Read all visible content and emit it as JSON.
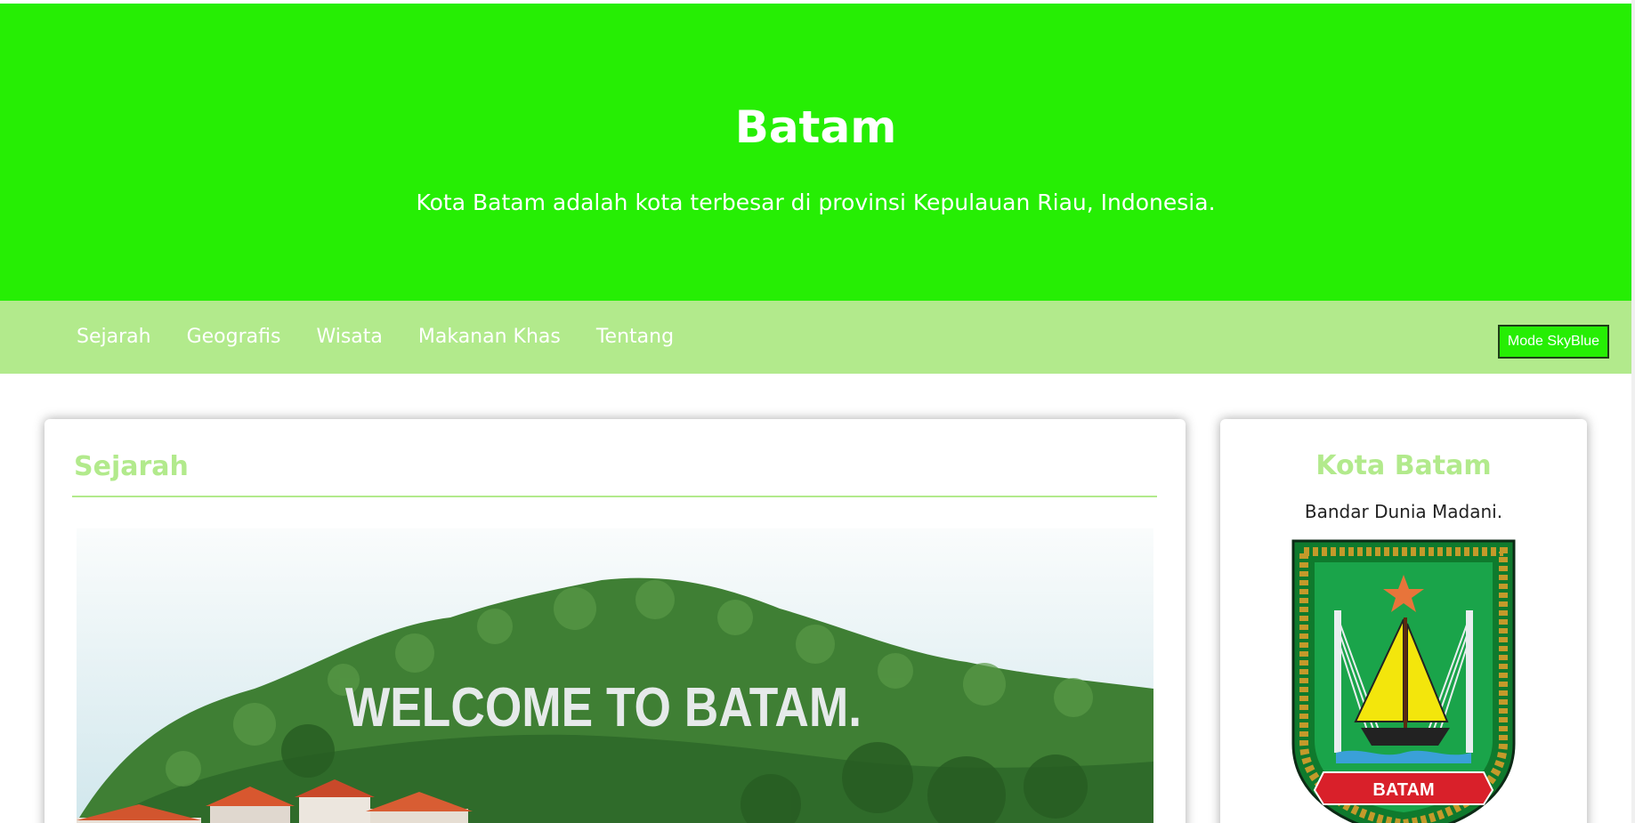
{
  "header": {
    "title": "Batam",
    "subtitle": "Kota Batam adalah kota terbesar di provinsi Kepulauan Riau, Indonesia."
  },
  "nav": {
    "items": [
      {
        "label": "Sejarah"
      },
      {
        "label": "Geografis"
      },
      {
        "label": "Wisata"
      },
      {
        "label": "Makanan Khas"
      },
      {
        "label": "Tentang"
      }
    ],
    "mode_button": "Mode SkyBlue"
  },
  "main": {
    "section_title": "Sejarah",
    "photo_sign_text": "WELCOME TO BATAM."
  },
  "sidebar": {
    "title": "Kota Batam",
    "tagline": "Bandar Dunia Madani.",
    "emblem_banner": "BATAM"
  },
  "colors": {
    "primary": "#26ee04",
    "secondary": "#b2ea8c"
  }
}
